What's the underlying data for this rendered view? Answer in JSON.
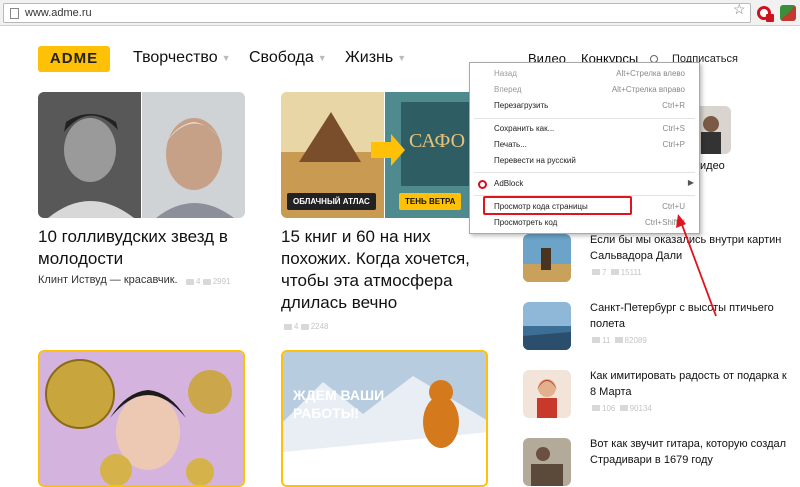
{
  "browser": {
    "url": "www.adme.ru"
  },
  "site": {
    "logo": "ADME",
    "nav": [
      "Творчество",
      "Свобода",
      "Жизнь"
    ],
    "links": [
      "Видео",
      "Конкурсы"
    ],
    "subscribe": "Подписаться"
  },
  "cards": [
    {
      "title": "10 голливудских звезд в молодости",
      "subtitle": "Клинт Иствуд — красавчик.",
      "comments": "4",
      "views": "2991"
    },
    {
      "title": "15 книг и 60 на них похожих. Когда хочется, чтобы эта атмосфера длилась вечно",
      "badge_left": "ОБЛАЧНЫЙ АТЛАС",
      "badge_right": "ТЕНЬ ВЕТРА",
      "comments": "4",
      "views": "2248"
    },
    {
      "title": ""
    },
    {
      "overlay": "ЖДЕМ ВАШИ РАБОТЫ!"
    }
  ],
  "sidebar": {
    "partial_label": "идео",
    "items": [
      {
        "title": "Если бы мы оказались внутри картин Сальвадора Дали",
        "comments": "7",
        "views": "15111"
      },
      {
        "title": "Санкт-Петербург с высоты птичьего полета",
        "comments": "11",
        "views": "82089"
      },
      {
        "title": "Как имитировать радость от подарка к 8 Марта",
        "comments": "106",
        "views": "90134"
      },
      {
        "title": "Вот как звучит гитара, которую создал Страдивари в 1679 году",
        "comments": "",
        "views": ""
      }
    ]
  },
  "context_menu": {
    "items": [
      {
        "label": "Назад",
        "shortcut": "Alt+Стрелка влево",
        "disabled": true
      },
      {
        "label": "Вперед",
        "shortcut": "Alt+Стрелка вправо",
        "disabled": true
      },
      {
        "label": "Перезагрузить",
        "shortcut": "Ctrl+R"
      },
      {
        "label": "Сохранить как...",
        "shortcut": "Ctrl+S"
      },
      {
        "label": "Печать...",
        "shortcut": "Ctrl+P"
      },
      {
        "label": "Перевести на русский",
        "shortcut": ""
      },
      {
        "label": "AdBlock",
        "shortcut": ""
      },
      {
        "label": "Просмотр кода страницы",
        "shortcut": "Ctrl+U"
      },
      {
        "label": "Просмотреть код",
        "shortcut": "Ctrl+Shift+I"
      }
    ]
  },
  "colors": {
    "accent": "#ffc107",
    "highlight": "#e0141e"
  }
}
